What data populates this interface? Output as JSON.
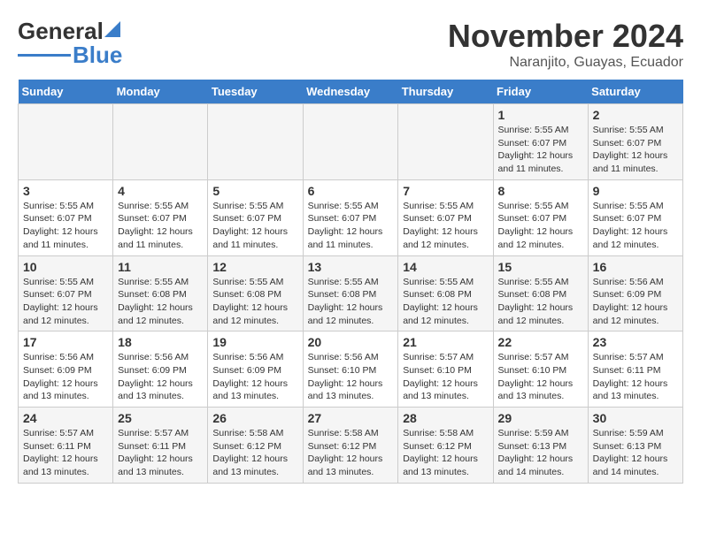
{
  "header": {
    "logo_line1": "General",
    "logo_line2": "Blue",
    "title": "November 2024",
    "subtitle": "Naranjito, Guayas, Ecuador"
  },
  "weekdays": [
    "Sunday",
    "Monday",
    "Tuesday",
    "Wednesday",
    "Thursday",
    "Friday",
    "Saturday"
  ],
  "weeks": [
    [
      {
        "day": "",
        "info": ""
      },
      {
        "day": "",
        "info": ""
      },
      {
        "day": "",
        "info": ""
      },
      {
        "day": "",
        "info": ""
      },
      {
        "day": "",
        "info": ""
      },
      {
        "day": "1",
        "info": "Sunrise: 5:55 AM\nSunset: 6:07 PM\nDaylight: 12 hours\nand 11 minutes."
      },
      {
        "day": "2",
        "info": "Sunrise: 5:55 AM\nSunset: 6:07 PM\nDaylight: 12 hours\nand 11 minutes."
      }
    ],
    [
      {
        "day": "3",
        "info": "Sunrise: 5:55 AM\nSunset: 6:07 PM\nDaylight: 12 hours\nand 11 minutes."
      },
      {
        "day": "4",
        "info": "Sunrise: 5:55 AM\nSunset: 6:07 PM\nDaylight: 12 hours\nand 11 minutes."
      },
      {
        "day": "5",
        "info": "Sunrise: 5:55 AM\nSunset: 6:07 PM\nDaylight: 12 hours\nand 11 minutes."
      },
      {
        "day": "6",
        "info": "Sunrise: 5:55 AM\nSunset: 6:07 PM\nDaylight: 12 hours\nand 11 minutes."
      },
      {
        "day": "7",
        "info": "Sunrise: 5:55 AM\nSunset: 6:07 PM\nDaylight: 12 hours\nand 12 minutes."
      },
      {
        "day": "8",
        "info": "Sunrise: 5:55 AM\nSunset: 6:07 PM\nDaylight: 12 hours\nand 12 minutes."
      },
      {
        "day": "9",
        "info": "Sunrise: 5:55 AM\nSunset: 6:07 PM\nDaylight: 12 hours\nand 12 minutes."
      }
    ],
    [
      {
        "day": "10",
        "info": "Sunrise: 5:55 AM\nSunset: 6:07 PM\nDaylight: 12 hours\nand 12 minutes."
      },
      {
        "day": "11",
        "info": "Sunrise: 5:55 AM\nSunset: 6:08 PM\nDaylight: 12 hours\nand 12 minutes."
      },
      {
        "day": "12",
        "info": "Sunrise: 5:55 AM\nSunset: 6:08 PM\nDaylight: 12 hours\nand 12 minutes."
      },
      {
        "day": "13",
        "info": "Sunrise: 5:55 AM\nSunset: 6:08 PM\nDaylight: 12 hours\nand 12 minutes."
      },
      {
        "day": "14",
        "info": "Sunrise: 5:55 AM\nSunset: 6:08 PM\nDaylight: 12 hours\nand 12 minutes."
      },
      {
        "day": "15",
        "info": "Sunrise: 5:55 AM\nSunset: 6:08 PM\nDaylight: 12 hours\nand 12 minutes."
      },
      {
        "day": "16",
        "info": "Sunrise: 5:56 AM\nSunset: 6:09 PM\nDaylight: 12 hours\nand 12 minutes."
      }
    ],
    [
      {
        "day": "17",
        "info": "Sunrise: 5:56 AM\nSunset: 6:09 PM\nDaylight: 12 hours\nand 13 minutes."
      },
      {
        "day": "18",
        "info": "Sunrise: 5:56 AM\nSunset: 6:09 PM\nDaylight: 12 hours\nand 13 minutes."
      },
      {
        "day": "19",
        "info": "Sunrise: 5:56 AM\nSunset: 6:09 PM\nDaylight: 12 hours\nand 13 minutes."
      },
      {
        "day": "20",
        "info": "Sunrise: 5:56 AM\nSunset: 6:10 PM\nDaylight: 12 hours\nand 13 minutes."
      },
      {
        "day": "21",
        "info": "Sunrise: 5:57 AM\nSunset: 6:10 PM\nDaylight: 12 hours\nand 13 minutes."
      },
      {
        "day": "22",
        "info": "Sunrise: 5:57 AM\nSunset: 6:10 PM\nDaylight: 12 hours\nand 13 minutes."
      },
      {
        "day": "23",
        "info": "Sunrise: 5:57 AM\nSunset: 6:11 PM\nDaylight: 12 hours\nand 13 minutes."
      }
    ],
    [
      {
        "day": "24",
        "info": "Sunrise: 5:57 AM\nSunset: 6:11 PM\nDaylight: 12 hours\nand 13 minutes."
      },
      {
        "day": "25",
        "info": "Sunrise: 5:57 AM\nSunset: 6:11 PM\nDaylight: 12 hours\nand 13 minutes."
      },
      {
        "day": "26",
        "info": "Sunrise: 5:58 AM\nSunset: 6:12 PM\nDaylight: 12 hours\nand 13 minutes."
      },
      {
        "day": "27",
        "info": "Sunrise: 5:58 AM\nSunset: 6:12 PM\nDaylight: 12 hours\nand 13 minutes."
      },
      {
        "day": "28",
        "info": "Sunrise: 5:58 AM\nSunset: 6:12 PM\nDaylight: 12 hours\nand 13 minutes."
      },
      {
        "day": "29",
        "info": "Sunrise: 5:59 AM\nSunset: 6:13 PM\nDaylight: 12 hours\nand 14 minutes."
      },
      {
        "day": "30",
        "info": "Sunrise: 5:59 AM\nSunset: 6:13 PM\nDaylight: 12 hours\nand 14 minutes."
      }
    ]
  ]
}
